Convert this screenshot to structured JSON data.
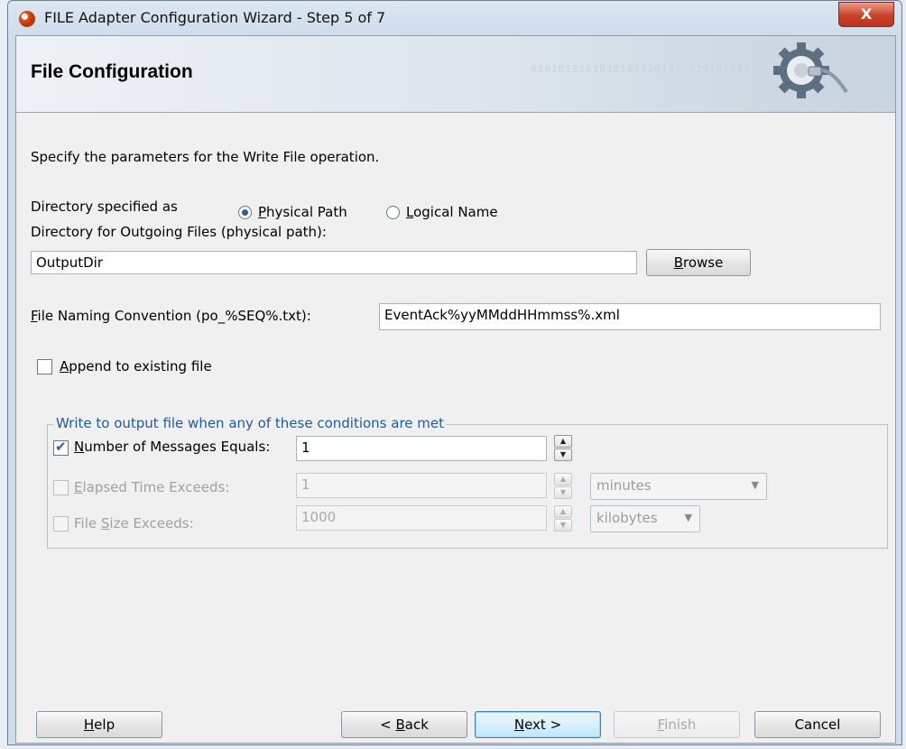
{
  "window": {
    "title": "FILE Adapter Configuration Wizard - Step 5 of 7",
    "close_glyph": "X"
  },
  "header": {
    "title": "File Configuration",
    "decoration_binary": "0101010101010101010101 010101010"
  },
  "intro": "Specify the parameters for the Write File operation.",
  "directory": {
    "specified_as_label": "Directory specified as",
    "option_physical": "Physical Path",
    "option_logical": "Logical Name",
    "selected": "Physical Path",
    "outgoing_label": "Directory for Outgoing Files (physical path):",
    "outgoing_value": "OutputDir",
    "browse_label": "Browse"
  },
  "naming": {
    "label": "File Naming Convention (po_%SEQ%.txt):",
    "value": "EventAck%yyMMddHHmmss%.xml"
  },
  "append": {
    "label": "Append to existing file",
    "checked": false
  },
  "conditions": {
    "legend": "Write to output file when any of these conditions are met",
    "messages": {
      "label": "Number of Messages Equals:",
      "checked": true,
      "value": "1",
      "enabled": true
    },
    "elapsed": {
      "label": "Elapsed Time Exceeds:",
      "checked": false,
      "value": "1",
      "unit": "minutes",
      "enabled": false
    },
    "filesize": {
      "label": "File Size Exceeds:",
      "checked": false,
      "value": "1000",
      "unit": "kilobytes",
      "enabled": false
    }
  },
  "buttons": {
    "help": "Help",
    "back": "< Back",
    "next": "Next >",
    "finish": "Finish",
    "cancel": "Cancel"
  },
  "colors": {
    "accent": "#1f5a9c",
    "close": "#c9432b"
  }
}
